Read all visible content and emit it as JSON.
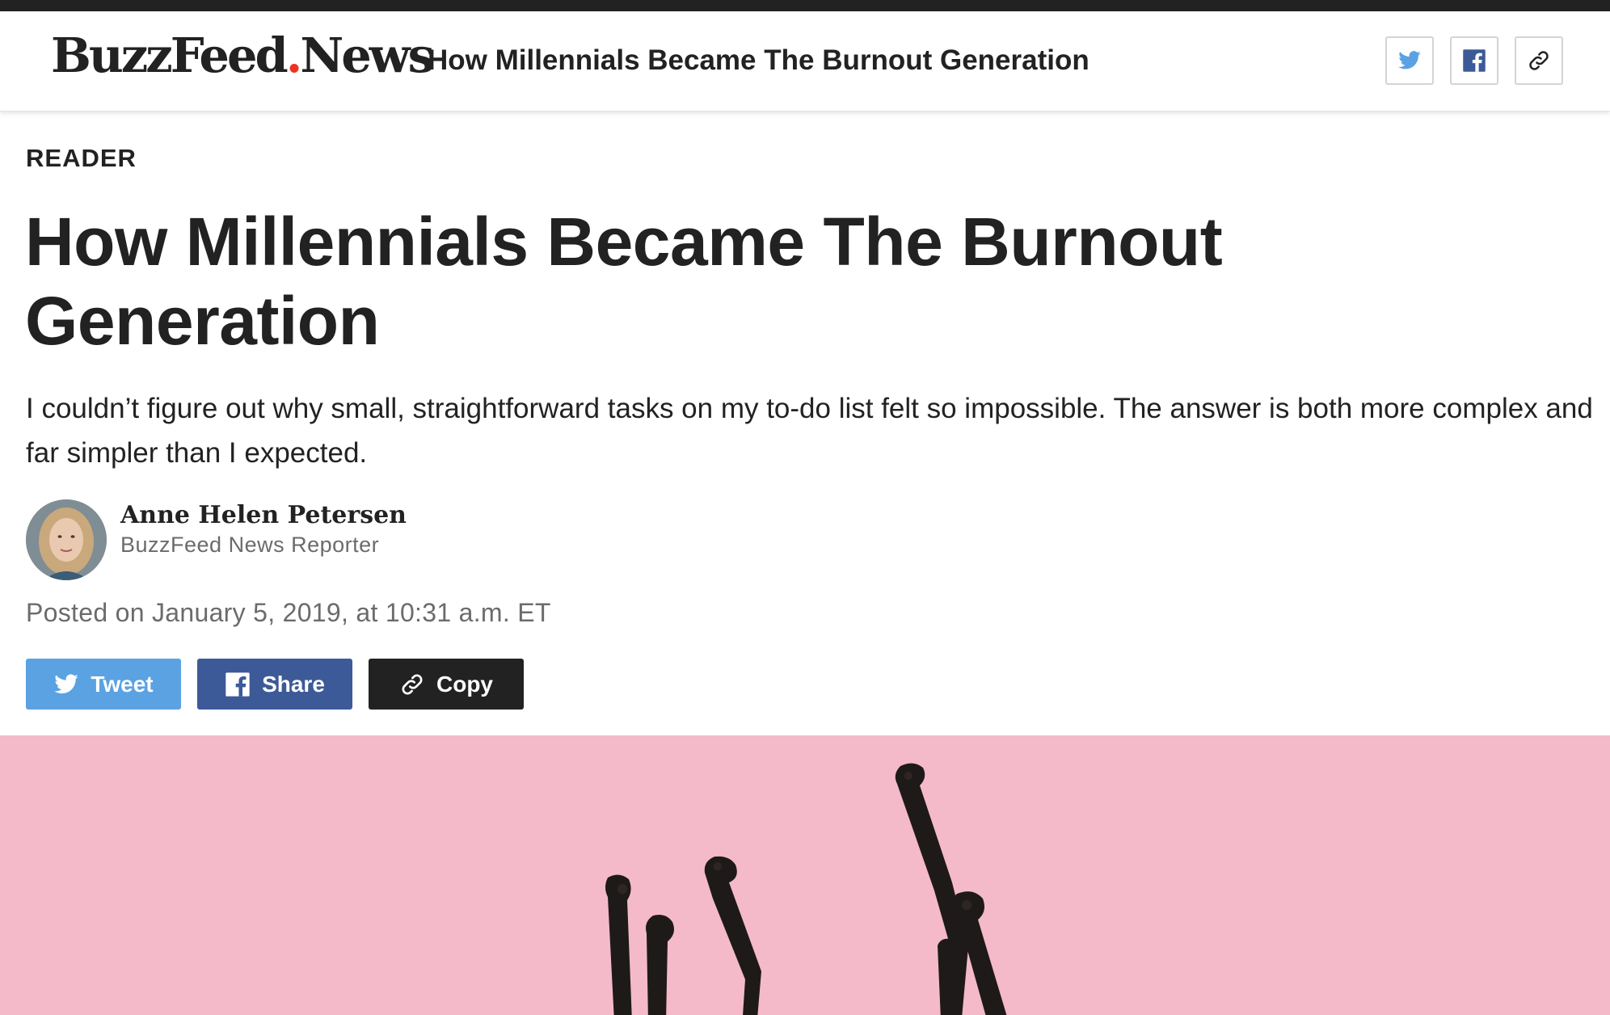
{
  "header": {
    "logo_primary": "BuzzFeed",
    "logo_dot": ".",
    "logo_secondary": "News",
    "article_title": "How Millennials Became The Burnout Generation",
    "share_icons": [
      "twitter-icon",
      "facebook-icon",
      "link-icon"
    ]
  },
  "article": {
    "category": "READER",
    "headline": "How Millennials Became The Burnout Generation",
    "dek": "I couldn’t figure out why small, straightforward tasks on my to-do list felt so impossible. The answer is both more complex and far simpler than I expected.",
    "author": {
      "name": "Anne Helen Petersen",
      "role": "BuzzFeed News Reporter"
    },
    "posted": "Posted on January 5, 2019, at 10:31 a.m. ET"
  },
  "share_buttons": {
    "tweet_label": "Tweet",
    "share_label": "Share",
    "copy_label": "Copy"
  },
  "colors": {
    "brand_dot": "#ee3322",
    "twitter": "#5aa2e2",
    "facebook": "#3d5a98",
    "copy": "#222222",
    "hero_background": "#f4bac9"
  }
}
